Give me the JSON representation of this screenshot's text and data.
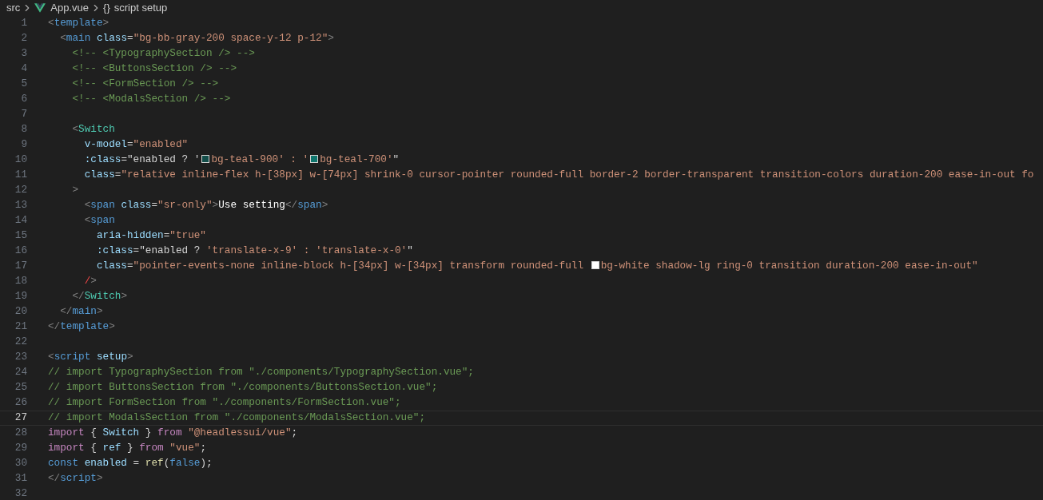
{
  "breadcrumb": {
    "folder": "src",
    "file": "App.vue",
    "symbol_glyph": "{}",
    "symbol": "script setup"
  },
  "lines": [
    {
      "number": "1",
      "selected": false,
      "tokens": [
        {
          "kind": "punct",
          "text": "<"
        },
        {
          "kind": "tag",
          "text": "template"
        },
        {
          "kind": "punct",
          "text": ">"
        }
      ]
    },
    {
      "number": "2",
      "selected": false,
      "tokens": [
        {
          "kind": "punct",
          "text": "  <"
        },
        {
          "kind": "tag",
          "text": "main"
        },
        {
          "kind": "attr",
          "text": " class"
        },
        {
          "kind": "plain",
          "text": "="
        },
        {
          "kind": "string",
          "text": "\"bg-bb-gray-200 space-y-12 p-12\""
        },
        {
          "kind": "punct",
          "text": ">"
        }
      ]
    },
    {
      "number": "3",
      "selected": false,
      "tokens": [
        {
          "kind": "comment",
          "text": "    <!-- <TypographySection /> -->"
        }
      ]
    },
    {
      "number": "4",
      "selected": false,
      "tokens": [
        {
          "kind": "comment",
          "text": "    <!-- <ButtonsSection /> -->"
        }
      ]
    },
    {
      "number": "5",
      "selected": false,
      "tokens": [
        {
          "kind": "comment",
          "text": "    <!-- <FormSection /> -->"
        }
      ]
    },
    {
      "number": "6",
      "selected": false,
      "tokens": [
        {
          "kind": "comment",
          "text": "    <!-- <ModalsSection /> -->"
        }
      ]
    },
    {
      "number": "7",
      "selected": false
    },
    {
      "number": "8",
      "selected": false,
      "tokens": [
        {
          "kind": "punct",
          "text": "    <"
        },
        {
          "kind": "component",
          "text": "Switch"
        }
      ]
    },
    {
      "number": "9",
      "selected": false,
      "tokens": [
        {
          "kind": "attr",
          "text": "      v-model"
        },
        {
          "kind": "plain",
          "text": "="
        },
        {
          "kind": "string",
          "text": "\"enabled\""
        }
      ]
    },
    {
      "number": "10",
      "selected": false,
      "tokens": [
        {
          "kind": "attr",
          "text": "      :class"
        },
        {
          "kind": "plain",
          "text": "="
        },
        {
          "kind": "plain",
          "text": "\"enabled ? '"
        },
        {
          "kind": "swatch",
          "color": "#134e4a"
        },
        {
          "kind": "string",
          "text": "bg-teal-900' : '"
        },
        {
          "kind": "swatch",
          "color": "#0f766e"
        },
        {
          "kind": "string",
          "text": "bg-teal-700'"
        },
        {
          "kind": "plain",
          "text": "\""
        }
      ]
    },
    {
      "number": "11",
      "selected": false,
      "tokens": [
        {
          "kind": "attr",
          "text": "      class"
        },
        {
          "kind": "plain",
          "text": "="
        },
        {
          "kind": "string",
          "text": "\"relative inline-flex h-[38px] w-[74px] shrink-0 cursor-pointer rounded-full border-2 border-transparent transition-colors duration-200 ease-in-out fo"
        }
      ]
    },
    {
      "number": "12",
      "selected": false,
      "tokens": [
        {
          "kind": "punct",
          "text": "    >"
        }
      ]
    },
    {
      "number": "13",
      "selected": false,
      "tokens": [
        {
          "kind": "punct",
          "text": "      <"
        },
        {
          "kind": "tag",
          "text": "span"
        },
        {
          "kind": "attr",
          "text": " class"
        },
        {
          "kind": "plain",
          "text": "="
        },
        {
          "kind": "string",
          "text": "\"sr-only\""
        },
        {
          "kind": "punct",
          "text": ">"
        },
        {
          "kind": "text",
          "text": "Use setting"
        },
        {
          "kind": "punct",
          "text": "</"
        },
        {
          "kind": "tag",
          "text": "span"
        },
        {
          "kind": "punct",
          "text": ">"
        }
      ]
    },
    {
      "number": "14",
      "selected": false,
      "tokens": [
        {
          "kind": "punct",
          "text": "      <"
        },
        {
          "kind": "tag",
          "text": "span"
        }
      ]
    },
    {
      "number": "15",
      "selected": false,
      "tokens": [
        {
          "kind": "attr",
          "text": "        aria-hidden"
        },
        {
          "kind": "plain",
          "text": "="
        },
        {
          "kind": "string",
          "text": "\"true\""
        }
      ]
    },
    {
      "number": "16",
      "selected": false,
      "tokens": [
        {
          "kind": "attr",
          "text": "        :class"
        },
        {
          "kind": "plain",
          "text": "="
        },
        {
          "kind": "plain",
          "text": "\"enabled ? "
        },
        {
          "kind": "string",
          "text": "'translate-x-9' : 'translate-x-0'"
        },
        {
          "kind": "plain",
          "text": "\""
        }
      ]
    },
    {
      "number": "17",
      "selected": false,
      "tokens": [
        {
          "kind": "attr",
          "text": "        class"
        },
        {
          "kind": "plain",
          "text": "="
        },
        {
          "kind": "string",
          "text": "\"pointer-events-none inline-block h-[34px] w-[34px] transform rounded-full "
        },
        {
          "kind": "swatch",
          "color": "#ffffff"
        },
        {
          "kind": "string",
          "text": "bg-white shadow-lg ring-0 transition duration-200 ease-in-out\""
        }
      ]
    },
    {
      "number": "18",
      "selected": false,
      "tokens": [
        {
          "kind": "error",
          "text": "      /"
        },
        {
          "kind": "punct",
          "text": ">"
        }
      ]
    },
    {
      "number": "19",
      "selected": false,
      "tokens": [
        {
          "kind": "punct",
          "text": "    </"
        },
        {
          "kind": "component",
          "text": "Switch"
        },
        {
          "kind": "punct",
          "text": ">"
        }
      ]
    },
    {
      "number": "20",
      "selected": false,
      "tokens": [
        {
          "kind": "punct",
          "text": "  </"
        },
        {
          "kind": "tag",
          "text": "main"
        },
        {
          "kind": "punct",
          "text": ">"
        }
      ]
    },
    {
      "number": "21",
      "selected": false,
      "tokens": [
        {
          "kind": "punct",
          "text": "</"
        },
        {
          "kind": "tag",
          "text": "template"
        },
        {
          "kind": "punct",
          "text": ">"
        }
      ]
    },
    {
      "number": "22",
      "selected": false
    },
    {
      "number": "23",
      "selected": false,
      "tokens": [
        {
          "kind": "punct",
          "text": "<"
        },
        {
          "kind": "tag",
          "text": "script"
        },
        {
          "kind": "attr",
          "text": " setup"
        },
        {
          "kind": "punct",
          "text": ">"
        }
      ]
    },
    {
      "number": "24",
      "selected": false,
      "tokens": [
        {
          "kind": "comment",
          "text": "// import TypographySection from \"./components/TypographySection.vue\";"
        }
      ]
    },
    {
      "number": "25",
      "selected": false,
      "tokens": [
        {
          "kind": "comment",
          "text": "// import ButtonsSection from \"./components/ButtonsSection.vue\";"
        }
      ]
    },
    {
      "number": "26",
      "selected": false,
      "tokens": [
        {
          "kind": "comment",
          "text": "// import FormSection from \"./components/FormSection.vue\";"
        }
      ]
    },
    {
      "number": "27",
      "selected": true,
      "tokens": [
        {
          "kind": "comment",
          "text": "// import ModalsSection from \"./components/ModalsSection.vue\";"
        }
      ]
    },
    {
      "number": "28",
      "selected": false,
      "tokens": [
        {
          "kind": "keyword",
          "text": "import"
        },
        {
          "kind": "plain",
          "text": " { "
        },
        {
          "kind": "variable",
          "text": "Switch"
        },
        {
          "kind": "plain",
          "text": " } "
        },
        {
          "kind": "keyword",
          "text": "from"
        },
        {
          "kind": "string",
          "text": " \"@headlessui/vue\""
        },
        {
          "kind": "plain",
          "text": ";"
        }
      ]
    },
    {
      "number": "29",
      "selected": false,
      "tokens": [
        {
          "kind": "keyword",
          "text": "import"
        },
        {
          "kind": "plain",
          "text": " { "
        },
        {
          "kind": "variable",
          "text": "ref"
        },
        {
          "kind": "plain",
          "text": " } "
        },
        {
          "kind": "keyword",
          "text": "from"
        },
        {
          "kind": "string",
          "text": " \"vue\""
        },
        {
          "kind": "plain",
          "text": ";"
        }
      ]
    },
    {
      "number": "30",
      "selected": false,
      "tokens": [
        {
          "kind": "storage",
          "text": "const"
        },
        {
          "kind": "variable",
          "text": " enabled"
        },
        {
          "kind": "plain",
          "text": " = "
        },
        {
          "kind": "function",
          "text": "ref"
        },
        {
          "kind": "plain",
          "text": "("
        },
        {
          "kind": "storage",
          "text": "false"
        },
        {
          "kind": "plain",
          "text": ");"
        }
      ]
    },
    {
      "number": "31",
      "selected": false,
      "tokens": [
        {
          "kind": "punct",
          "text": "</"
        },
        {
          "kind": "tag",
          "text": "script"
        },
        {
          "kind": "punct",
          "text": ">"
        }
      ]
    },
    {
      "number": "32",
      "selected": false
    }
  ]
}
